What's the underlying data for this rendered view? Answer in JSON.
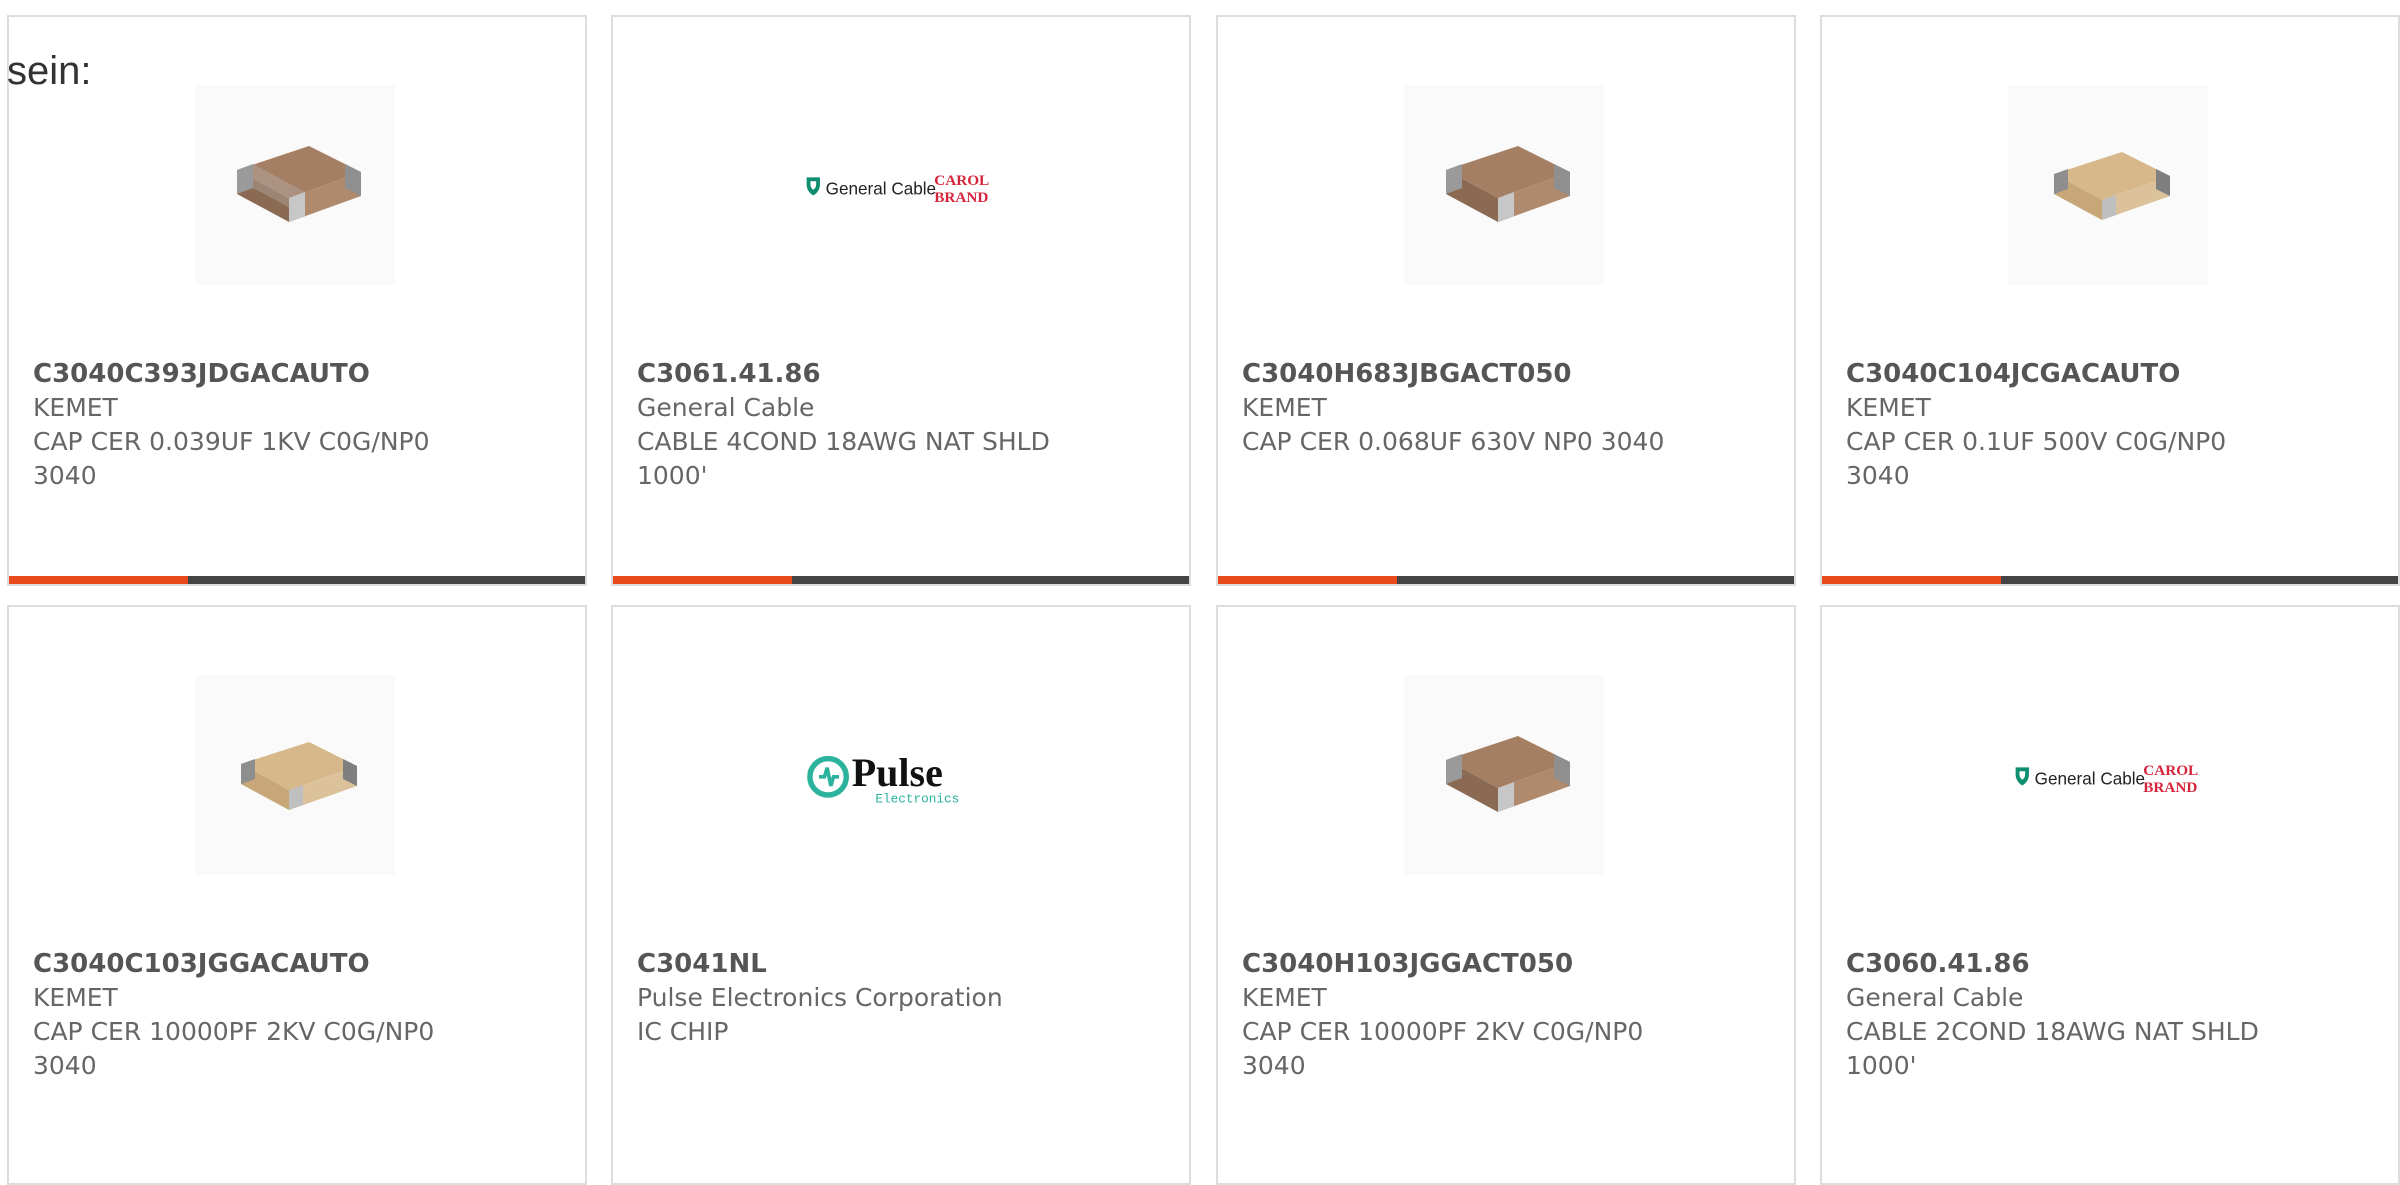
{
  "intro_text": "sein:",
  "colors": {
    "accent": "#e84a1c",
    "bar_track": "#444444",
    "border": "#dddddd"
  },
  "cards": [
    {
      "part_number": "C3040C393JDGACAUTO",
      "manufacturer": "KEMET",
      "description": "CAP CER 0.039UF 1KV C0G/NP0 3040",
      "image": "capacitor-chip-dark",
      "progress": 0.31
    },
    {
      "part_number": "C3061.41.86",
      "manufacturer": "General Cable",
      "description": "CABLE 4COND 18AWG NAT SHLD 1000'",
      "image": "general-cable-logo",
      "logo_left": "General Cable",
      "logo_right_1": "CAROL",
      "logo_right_2": "BRAND",
      "progress": 0.31
    },
    {
      "part_number": "C3040H683JBGACT050",
      "manufacturer": "KEMET",
      "description": "CAP CER 0.068UF 630V NP0 3040",
      "image": "capacitor-chip-dark",
      "progress": 0.31
    },
    {
      "part_number": "C3040C104JCGACAUTO",
      "manufacturer": "KEMET",
      "description": "CAP CER 0.1UF 500V C0G/NP0 3040",
      "image": "capacitor-chip-light",
      "progress": 0.31
    },
    {
      "part_number": "C3040C103JGGACAUTO",
      "manufacturer": "KEMET",
      "description": "CAP CER 10000PF 2KV C0G/NP0 3040",
      "image": "capacitor-chip-light"
    },
    {
      "part_number": "C3041NL",
      "manufacturer": "Pulse Electronics Corporation",
      "description": "IC CHIP",
      "image": "pulse-electronics-logo",
      "logo_main": "Pulse",
      "logo_sub": "Electronics"
    },
    {
      "part_number": "C3040H103JGGACT050",
      "manufacturer": "KEMET",
      "description": "CAP CER 10000PF 2KV C0G/NP0 3040",
      "image": "capacitor-chip-dark"
    },
    {
      "part_number": "C3060.41.86",
      "manufacturer": "General Cable",
      "description": "CABLE 2COND 18AWG NAT SHLD 1000'",
      "image": "general-cable-logo",
      "logo_left": "General Cable",
      "logo_right_1": "CAROL",
      "logo_right_2": "BRAND"
    }
  ]
}
